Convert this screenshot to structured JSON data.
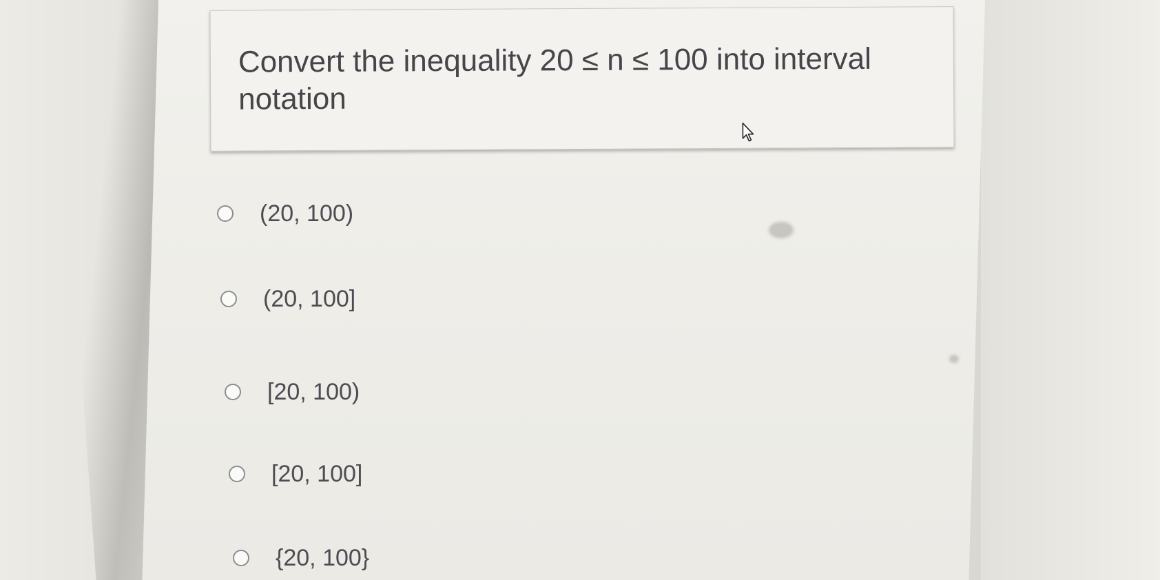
{
  "question": {
    "text": "Convert the inequality 20 ≤ n ≤ 100 into interval notation"
  },
  "options": [
    {
      "label": "(20, 100)"
    },
    {
      "label": "(20, 100]"
    },
    {
      "label": "[20, 100)"
    },
    {
      "label": "[20, 100]"
    },
    {
      "label": "{20, 100}"
    }
  ],
  "icons": {
    "cursor": "mouse-pointer-icon",
    "radio": "radio-button-icon"
  },
  "colors": {
    "text": "#45454a",
    "card_background": "#f3f2ee",
    "radio_border": "#8e8e92"
  }
}
